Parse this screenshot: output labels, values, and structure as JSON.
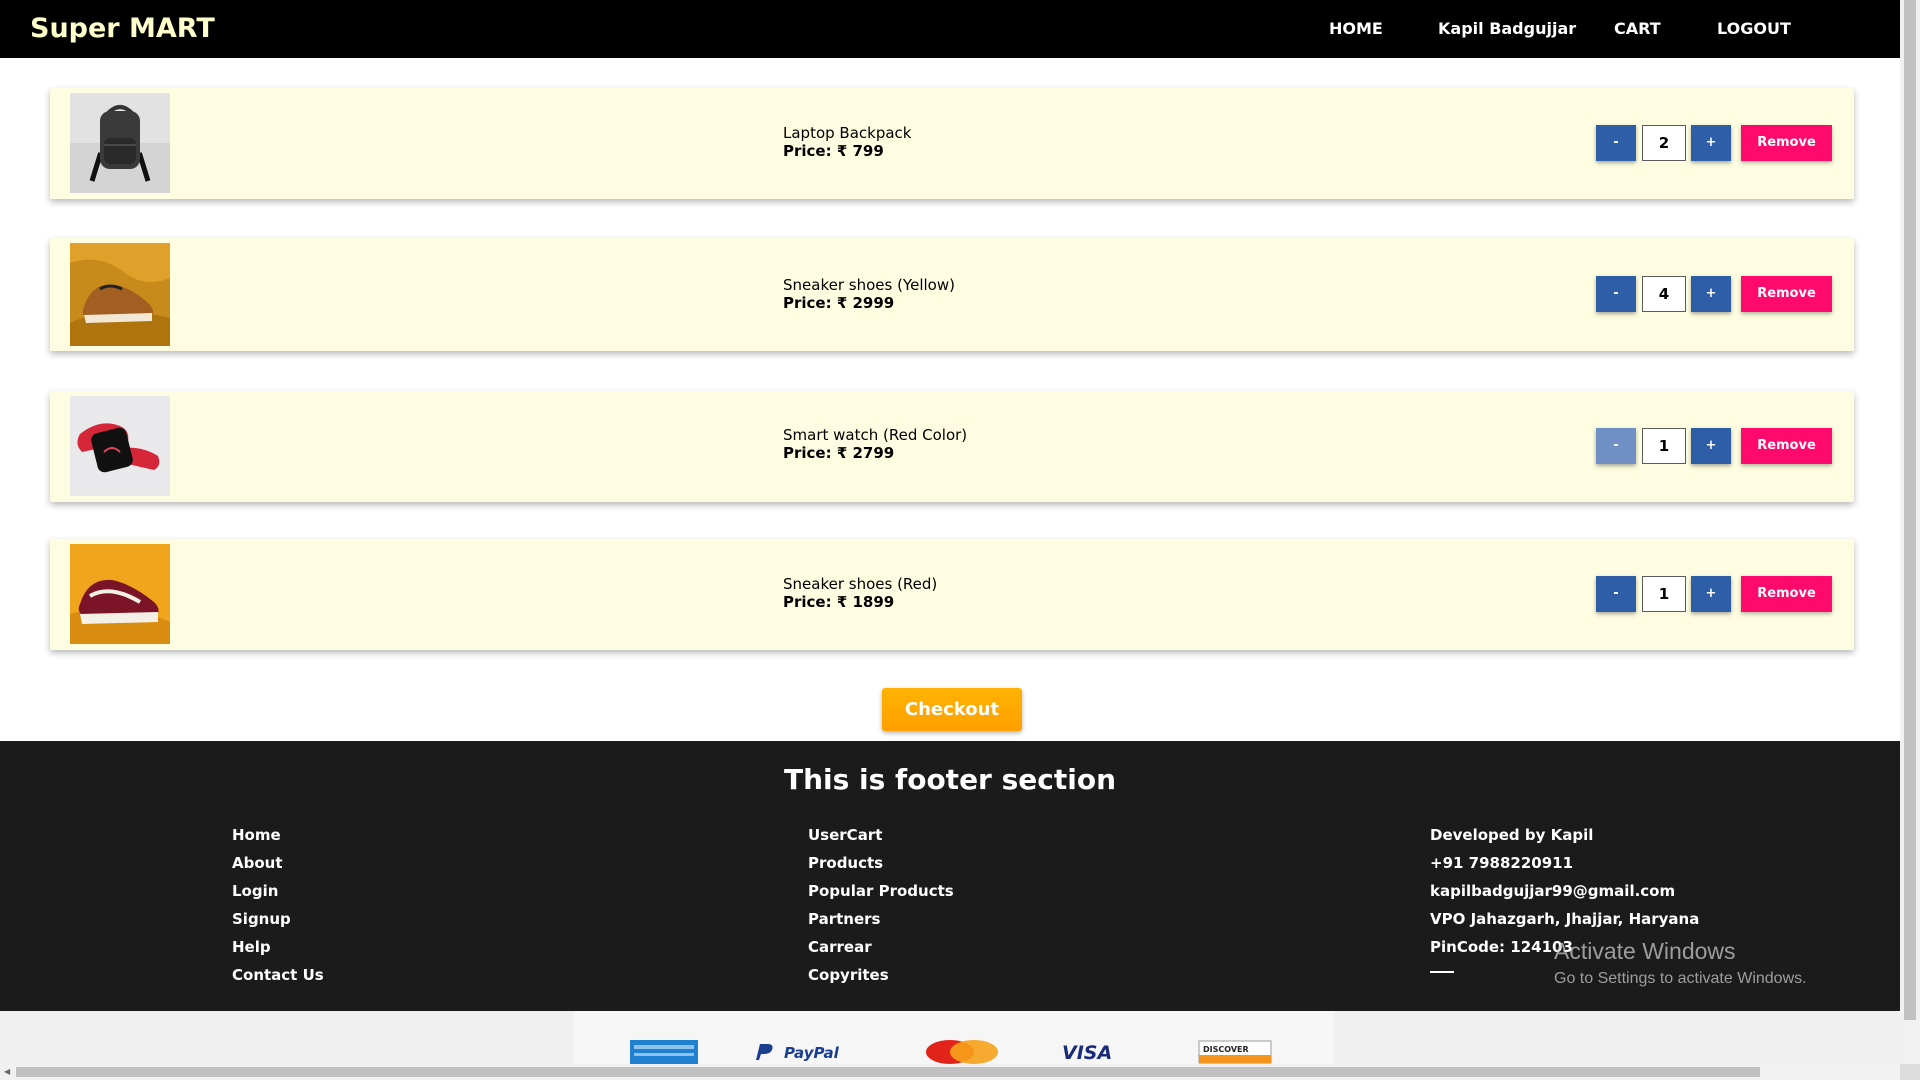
{
  "navbar": {
    "brand": "Super MART",
    "home": "HOME",
    "user": "Kapil Badgujjar",
    "cart": "CART",
    "logout": "LOGOUT"
  },
  "cart": {
    "items": [
      {
        "name": "Laptop Backpack",
        "price": "Price: ₹ 799",
        "quantity": "2",
        "minus": "-",
        "plus": "+",
        "remove": "Remove",
        "image_icon": "backpack-icon"
      },
      {
        "name": "Sneaker shoes (Yellow)",
        "price": "Price: ₹ 2999",
        "quantity": "4",
        "minus": "-",
        "plus": "+",
        "remove": "Remove",
        "image_icon": "sneaker-icon"
      },
      {
        "name": "Smart watch (Red Color)",
        "price": "Price: ₹ 2799",
        "quantity": "1",
        "minus": "-",
        "plus": "+",
        "remove": "Remove",
        "image_icon": "smartwatch-icon"
      },
      {
        "name": "Sneaker shoes (Red)",
        "price": "Price: ₹ 1899",
        "quantity": "1",
        "minus": "-",
        "plus": "+",
        "remove": "Remove",
        "image_icon": "sneaker-icon"
      }
    ],
    "checkout": "Checkout"
  },
  "footer": {
    "title": "This is footer section",
    "col1": [
      "Home",
      "About",
      "Login",
      "Signup",
      "Help",
      "Contact Us"
    ],
    "col2": [
      "UserCart",
      "Products",
      "Popular Products",
      "Partners",
      "Carrear",
      "Copyrites"
    ],
    "col3": [
      "Developed by Kapil",
      "+91 7988220911",
      "kapilbadgujjar99@gmail.com",
      "VPO Jahazgarh, Jhajjar, Haryana",
      "PinCode: 124103"
    ]
  },
  "watermark": {
    "title": "Activate Windows",
    "subtitle": "Go to Settings to activate Windows."
  },
  "payments": {
    "logos": [
      "american-express-logo",
      "paypal-logo",
      "mastercard-logo",
      "visa-logo",
      "discover-logo"
    ],
    "paypal_text": "PayPal",
    "visa_text": "VISA",
    "discover_text": "DISCOVER"
  },
  "colors": {
    "navbar_bg": "#000000",
    "brand": "#ffffcc",
    "card_bg": "#fffde1",
    "qty_button": "#2e5ea8",
    "remove_button": "#ff0a6c",
    "checkout_button": "#ffa500",
    "footer_bg": "#1b1b1b"
  }
}
